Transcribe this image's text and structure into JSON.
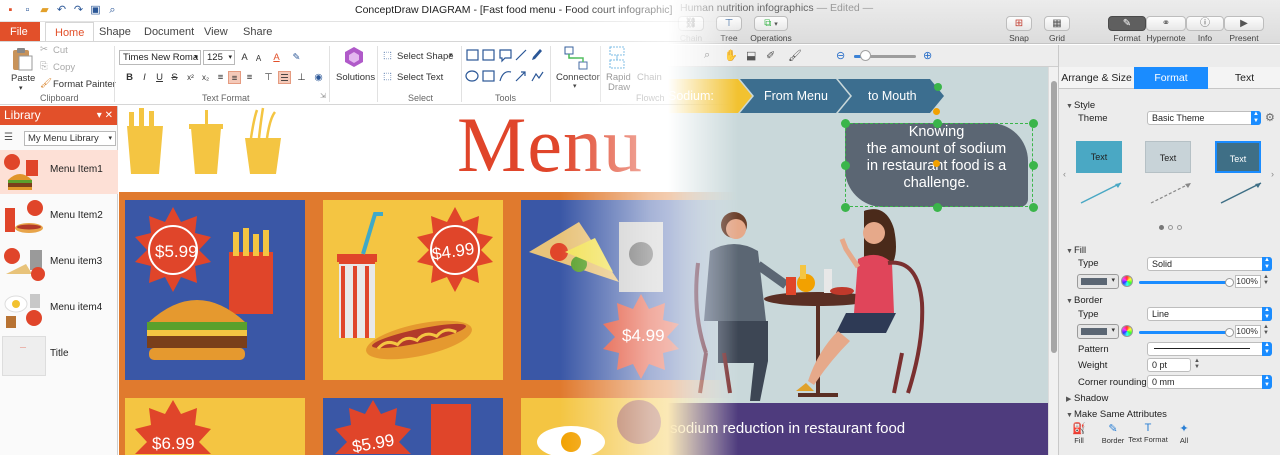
{
  "win": {
    "title": "ConceptDraw DIAGRAM - [Fast food menu - Food court infographic]",
    "tabs": [
      "File",
      "Home",
      "Shape",
      "Document",
      "View",
      "Share"
    ],
    "clipboard": {
      "paste": "Paste",
      "cut": "Cut",
      "copy": "Copy",
      "format_painter": "Format Painter",
      "label": "Clipboard"
    },
    "text_format": {
      "font": "Times New Roma",
      "size": "125",
      "label": "Text Format"
    },
    "solutions": "Solutions",
    "select": {
      "shape": "Select Shape",
      "text": "Select Text",
      "label": "Select"
    },
    "tools_label": "Tools",
    "connector": "Connector",
    "rapid_draw": [
      "Rapid",
      "Draw"
    ],
    "chain": "Chain",
    "flowchart_label": "Flowch",
    "library": {
      "header": "Library",
      "selected": "My Menu Library",
      "items": [
        "Menu Item1",
        "Menu Item2",
        "Menu item3",
        "Menu item4",
        "Title"
      ]
    },
    "canvas": {
      "menu_title": "Menu",
      "prices": [
        "$5.99",
        "$4.99",
        "$4.99",
        "$6.99",
        "$5.99"
      ]
    }
  },
  "mac": {
    "doc_title": "Human nutrition infographics",
    "edited": "— Edited —",
    "tool_labels": {
      "chain": "Chain",
      "tree": "Tree",
      "operations": "Operations",
      "snap": "Snap",
      "grid": "Grid",
      "format": "Format",
      "hypernote": "Hypernote",
      "info": "Info",
      "present": "Present"
    },
    "canvas": {
      "arrow": [
        "Sodium:",
        "From Menu",
        "to Mouth"
      ],
      "callout": [
        "Knowing",
        "the amount of sodium",
        "in restaurant food is a",
        "challenge."
      ],
      "footer": "sodium reduction in restaurant food"
    },
    "inspector": {
      "tabs": [
        "Arrange & Size",
        "Format",
        "Text"
      ],
      "style": {
        "section": "Style",
        "theme_label": "Theme",
        "theme_value": "Basic Theme",
        "tile_text": "Text"
      },
      "fill": {
        "section": "Fill",
        "type_label": "Type",
        "type_value": "Solid",
        "opacity": "100%",
        "opacity_value": 100
      },
      "border": {
        "section": "Border",
        "type_label": "Type",
        "type_value": "Line",
        "opacity": "100%",
        "opacity_value": 100,
        "pattern_label": "Pattern",
        "weight_label": "Weight",
        "weight_value": "0 pt",
        "corner_label": "Corner rounding",
        "corner_value": "0 mm"
      },
      "shadow": "Shadow",
      "make_same": "Make Same Attributes",
      "make_same_buttons": [
        "Fill",
        "Border",
        "Text Format",
        "All"
      ]
    },
    "colors": {
      "accent": "#1a8cff",
      "callout": "#5b6673",
      "footer_band": "#4e3b7d",
      "arrow_yellow": "#f2c230",
      "arrow_blue": "#3c6e8f"
    }
  }
}
